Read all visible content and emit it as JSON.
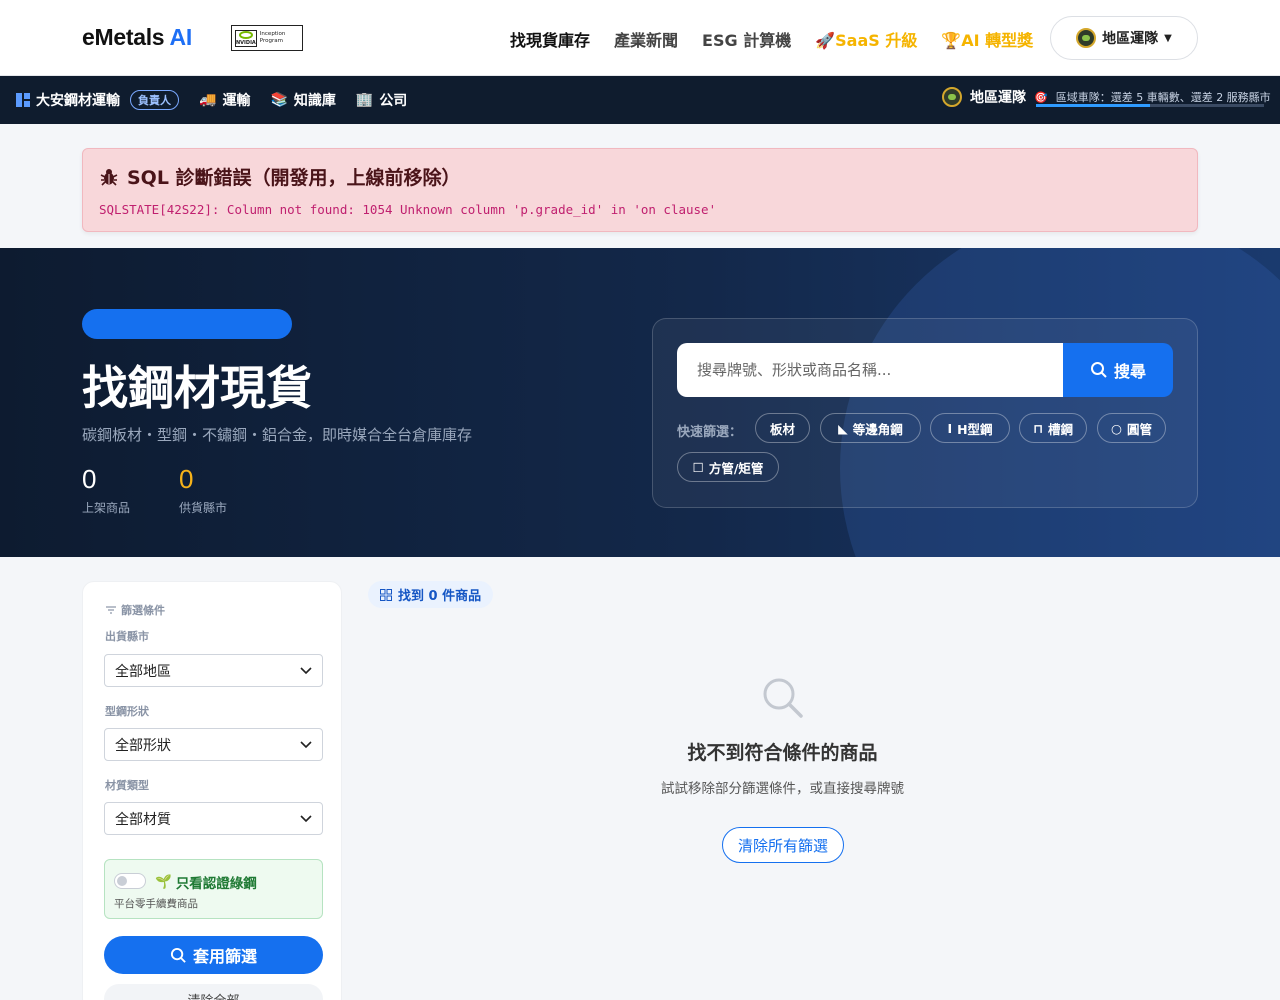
{
  "topnav": {
    "brand_main": "eMetals",
    "brand_ai": "AI",
    "nvidia_brand": "NVIDIA",
    "nvidia_program": "Inception Program",
    "links": [
      {
        "label": "找現貨庫存"
      },
      {
        "label": "產業新聞"
      },
      {
        "label": "ESG 計算機"
      },
      {
        "label": "SaaS 升級"
      },
      {
        "label": "AI 轉型獎"
      }
    ],
    "region_button": "地區運隊"
  },
  "subbar": {
    "company": "大安鋼材運輸",
    "owner_badge": "負責人",
    "links": [
      {
        "label": "運輸"
      },
      {
        "label": "知識庫"
      },
      {
        "label": "公司"
      }
    ],
    "region_title": "地區運隊",
    "region_status": "區域車隊：還差 5 車輛數、還差 2 服務縣市",
    "progress_fraction": 0.5
  },
  "error": {
    "title": "SQL 診斷錯誤（開發用，上線前移除）",
    "message": "SQLSTATE[42S22]: Column not found: 1054 Unknown column 'p.grade_id' in 'on clause'"
  },
  "hero": {
    "title": "找鋼材現貨",
    "subtitle": "碳鋼板材・型鋼・不鏽鋼・鋁合金，即時媒合全台倉庫庫存",
    "stats": [
      {
        "value": "0",
        "label": "上架商品"
      },
      {
        "value": "0",
        "label": "供貨縣市"
      }
    ],
    "search_placeholder": "搜尋牌號、形狀或商品名稱...",
    "search_button": "搜尋",
    "quick_label": "快速篩選：",
    "quick_filters": [
      {
        "label": "板材",
        "icon": ""
      },
      {
        "label": "等邊角鋼",
        "icon": "◣"
      },
      {
        "label": "H型鋼",
        "icon": "I"
      },
      {
        "label": "槽鋼",
        "icon": "⊓"
      },
      {
        "label": "圓管",
        "icon": "○"
      },
      {
        "label": "方管/矩管",
        "icon": "☐"
      }
    ]
  },
  "filters": {
    "heading": "篩選條件",
    "city_label": "出貨縣市",
    "city_value": "全部地區",
    "shape_label": "型鋼形狀",
    "shape_value": "全部形狀",
    "material_label": "材質類型",
    "material_value": "全部材質",
    "green_title": "只看認證綠鋼",
    "green_sub": "平台零手續費商品",
    "apply_button": "套用篩選",
    "clear_button": "清除全部"
  },
  "results": {
    "count_label": "找到 0 件商品",
    "empty_title": "找不到符合條件的商品",
    "empty_sub": "試試移除部分篩選條件，或直接搜尋牌號",
    "clear_all": "清除所有篩選"
  },
  "colors": {
    "primary": "#1570ef",
    "navy": "#0f1c2e",
    "accent_yellow": "#f5b400",
    "green": "#1f7a34",
    "error_text": "#c0206f"
  }
}
